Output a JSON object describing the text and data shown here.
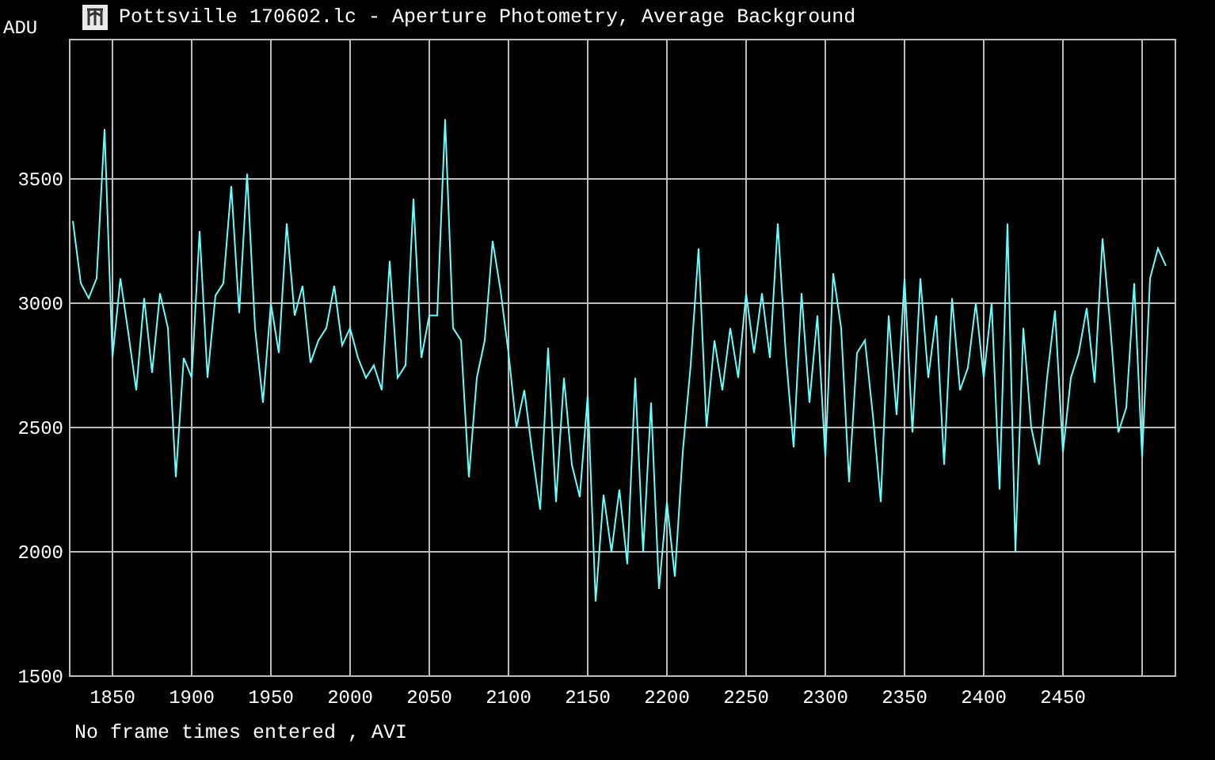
{
  "window": {
    "title": "Pottsville 170602.lc - Aperture Photometry, Average Background"
  },
  "chart_data": {
    "type": "line",
    "grid": true,
    "ylabel": "ADU",
    "xlim": [
      1823,
      2521
    ],
    "ylim": [
      1500,
      4060
    ],
    "xticks": [
      1850,
      1900,
      1950,
      2000,
      2050,
      2100,
      2150,
      2200,
      2250,
      2300,
      2350,
      2400,
      2450
    ],
    "yticks": [
      1500,
      2000,
      2500,
      3000,
      3500
    ],
    "x": [
      1825,
      1830,
      1835,
      1840,
      1845,
      1850,
      1855,
      1860,
      1865,
      1870,
      1875,
      1880,
      1885,
      1890,
      1895,
      1900,
      1905,
      1910,
      1915,
      1920,
      1925,
      1930,
      1935,
      1940,
      1945,
      1950,
      1955,
      1960,
      1965,
      1970,
      1975,
      1980,
      1985,
      1990,
      1995,
      2000,
      2005,
      2010,
      2015,
      2020,
      2025,
      2030,
      2035,
      2040,
      2045,
      2050,
      2055,
      2060,
      2065,
      2070,
      2075,
      2080,
      2085,
      2090,
      2095,
      2100,
      2105,
      2110,
      2115,
      2120,
      2125,
      2130,
      2135,
      2140,
      2145,
      2150,
      2155,
      2160,
      2165,
      2170,
      2175,
      2180,
      2185,
      2190,
      2195,
      2200,
      2205,
      2210,
      2215,
      2220,
      2225,
      2230,
      2235,
      2240,
      2245,
      2250,
      2255,
      2260,
      2265,
      2270,
      2275,
      2280,
      2285,
      2290,
      2295,
      2300,
      2305,
      2310,
      2315,
      2320,
      2325,
      2330,
      2335,
      2340,
      2345,
      2350,
      2355,
      2360,
      2365,
      2370,
      2375,
      2380,
      2385,
      2390,
      2395,
      2400,
      2405,
      2410,
      2415,
      2420,
      2425,
      2430,
      2435,
      2440,
      2445,
      2450,
      2455,
      2460,
      2465,
      2470,
      2475,
      2480,
      2485,
      2490,
      2495,
      2500,
      2505,
      2510,
      2515
    ],
    "series": [
      {
        "color": "#66ffff",
        "values": [
          3330,
          3080,
          3020,
          3100,
          3700,
          2780,
          3100,
          2880,
          2650,
          3020,
          2720,
          3040,
          2900,
          2300,
          2780,
          2700,
          3290,
          2700,
          3030,
          3080,
          3470,
          2960,
          3520,
          2900,
          2600,
          3000,
          2800,
          3320,
          2950,
          3070,
          2760,
          2850,
          2900,
          3070,
          2830,
          2900,
          2780,
          2700,
          2750,
          2650,
          3170,
          2700,
          2750,
          3420,
          2780,
          2950,
          2950,
          3740,
          2900,
          2850,
          2300,
          2700,
          2850,
          3250,
          3050,
          2800,
          2500,
          2650,
          2400,
          2170,
          2820,
          2200,
          2700,
          2350,
          2220,
          2630,
          1800,
          2230,
          2000,
          2250,
          1950,
          2700,
          2000,
          2600,
          1850,
          2200,
          1900,
          2400,
          2750,
          3220,
          2500,
          2850,
          2650,
          2900,
          2700,
          3040,
          2800,
          3040,
          2780,
          3320,
          2800,
          2420,
          3040,
          2600,
          2950,
          2380,
          3120,
          2900,
          2280,
          2800,
          2850,
          2550,
          2200,
          2950,
          2550,
          3100,
          2480,
          3100,
          2700,
          2950,
          2350,
          3020,
          2650,
          2740,
          3000,
          2700,
          3000,
          2250,
          3320,
          2000,
          2900,
          2500,
          2350,
          2700,
          2970,
          2400,
          2700,
          2800,
          2980,
          2680,
          3260,
          2900,
          2480,
          2580,
          3080,
          2380,
          3100,
          3220,
          3150
        ]
      }
    ]
  },
  "status": "No frame times entered , AVI"
}
